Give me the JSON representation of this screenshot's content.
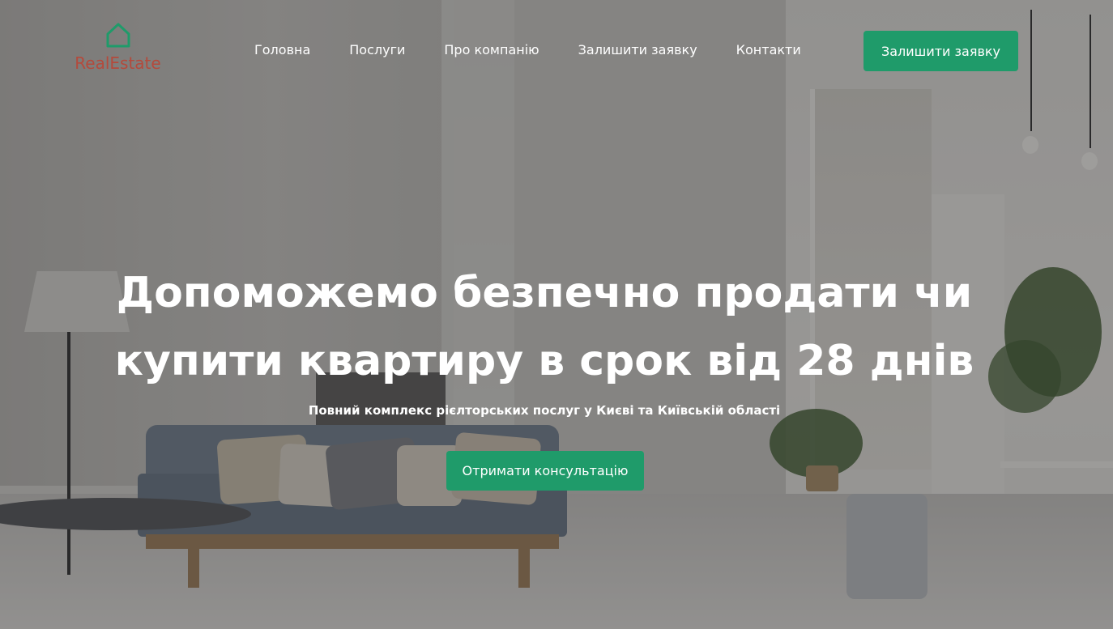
{
  "brand": {
    "name": "RealEstate",
    "icon": "house-outline-icon",
    "icon_color": "#1f9b6a",
    "text_color": "#b44a3c"
  },
  "nav": {
    "items": [
      {
        "label": "Головна"
      },
      {
        "label": "Послуги"
      },
      {
        "label": "Про компанію"
      },
      {
        "label": "Залишити заявку"
      },
      {
        "label": "Контакти"
      }
    ]
  },
  "header_cta": {
    "label": "Залишити заявку"
  },
  "hero": {
    "title_line1": "Допоможемо безпечно продати чи",
    "title_line2": "купити квартиру в срок від 28 днів",
    "subtitle": "Повний комплекс рієлторських послуг у Києві та Київській області",
    "cta_label": "Отримати консультацію"
  },
  "colors": {
    "accent": "#1f9b6a",
    "text_on_dark": "#ffffff"
  }
}
